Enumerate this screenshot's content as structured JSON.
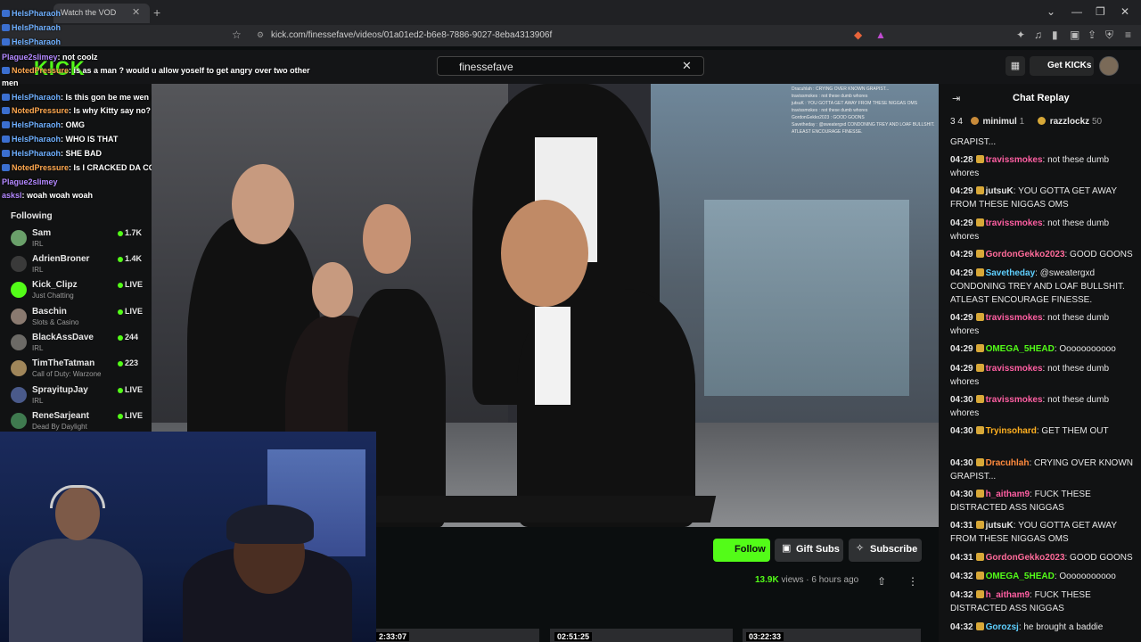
{
  "browser": {
    "tab_title": "Watch the VOD",
    "url": "kick.com/finessefave/videos/01a01ed2-b6e8-7886-9027-8eba4313906f"
  },
  "kick": {
    "logo": "KICK",
    "search_value": "finessefave",
    "get_kicks": "Get KICKs"
  },
  "overlay_chat": [
    {
      "user": "HelsPharaoh",
      "text": ""
    },
    {
      "user": "HelsPharaoh",
      "text": ""
    },
    {
      "user": "HelsPharaoh",
      "text": ""
    },
    {
      "user": "Plague2slimey",
      "text": ": not coolz"
    },
    {
      "user": "NotedPressure",
      "text": ": is as a man ? would u allow yoself to get angry over two other"
    },
    {
      "user": "",
      "text": "men"
    },
    {
      "user": "HelsPharaoh",
      "text": ": Is this gon be me wen i met the big scooter"
    },
    {
      "user": "NotedPressure",
      "text": ": Is why Kitty say no? she a man?"
    },
    {
      "user": "HelsPharaoh",
      "text": ": OMG"
    },
    {
      "user": "HelsPharaoh",
      "text": ": WHO IS THAT"
    },
    {
      "user": "HelsPharaoh",
      "text": ": SHE BAD"
    },
    {
      "user": "NotedPressure",
      "text": ": Is I CRACKED DA CODE"
    },
    {
      "user": "Plague2slimey",
      "text": ""
    },
    {
      "user": "asksl",
      "text": ": woah woah woah"
    }
  ],
  "sidebar": {
    "following_label": "Following",
    "channels": [
      {
        "name": "Sam",
        "category": "IRL",
        "stat": "1.7K",
        "avatar_color": "#6aa06a"
      },
      {
        "name": "AdrienBroner",
        "category": "IRL",
        "stat": "1.4K",
        "avatar_color": "#3a3a3a"
      },
      {
        "name": "Kick_Clipz",
        "category": "Just Chatting",
        "stat": "LIVE",
        "avatar_color": "#53fc18"
      },
      {
        "name": "Baschin",
        "category": "Slots & Casino",
        "stat": "LIVE",
        "avatar_color": "#8a7a70"
      },
      {
        "name": "BlackAssDave",
        "category": "IRL",
        "stat": "244",
        "avatar_color": "#6c6a66"
      },
      {
        "name": "TimTheTatman",
        "category": "Call of Duty: Warzone",
        "stat": "223",
        "avatar_color": "#a0865a"
      },
      {
        "name": "SprayitupJay",
        "category": "IRL",
        "stat": "LIVE",
        "avatar_color": "#4a5a8a"
      },
      {
        "name": "ReneSarjeant",
        "category": "Dead By Daylight",
        "stat": "LIVE",
        "avatar_color": "#3f7a4f"
      }
    ]
  },
  "video_overlay_chat": [
    "Dracuhlah : CRYING OVER KNOWN GRAPIST...",
    "travissmokes : not these dumb whores",
    "jutsuK : YOU GOTTA GET AWAY FROM THESE NIGGAS OMS",
    "travissmokes : not these dumb whores",
    "GordonGekko2023 : GOOD GOONS",
    "Savetheday : @sweatergxd CONDONING TREY AND LOAF BULLSHIT. ATLEAST ENCOURAGE FINESSE."
  ],
  "actions": {
    "follow": "Follow",
    "gift_subs": "Gift Subs",
    "subscribe": "Subscribe"
  },
  "meta": {
    "views": "13.9K",
    "views_label": "views",
    "dot": "·",
    "age": "6 hours ago"
  },
  "thumbnails": [
    {
      "time": "2:33:07"
    },
    {
      "time": "02:51:25"
    },
    {
      "time": "03:22:33"
    }
  ],
  "chat_replay": {
    "title": "Chat Replay",
    "pinned": {
      "count": "3",
      "count2": "4",
      "user1": "minimul",
      "count3": "1",
      "user2": "razzlockz",
      "count4": "50"
    },
    "first_line": "GRAPIST...",
    "messages": [
      {
        "time": "04:28",
        "user": "travissmokes",
        "color": "#ff5fa2",
        "text": ": not these dumb whores"
      },
      {
        "time": "04:29",
        "user": "jutsuK",
        "color": "#e6e6e6",
        "text": ": YOU GOTTA GET AWAY FROM THESE NIGGAS OMS"
      },
      {
        "time": "04:29",
        "user": "travissmokes",
        "color": "#ff5fa2",
        "text": ": not these dumb whores"
      },
      {
        "time": "04:29",
        "user": "GordonGekko2023",
        "color": "#ff6b9a",
        "text": ": GOOD GOONS"
      },
      {
        "time": "04:29",
        "user": "Savetheday",
        "color": "#5fd0ff",
        "text": ": @sweatergxd CONDONING TREY AND LOAF BULLSHIT. ATLEAST ENCOURAGE FINESSE."
      },
      {
        "time": "04:29",
        "user": "travissmokes",
        "color": "#ff5fa2",
        "text": ": not these dumb whores"
      },
      {
        "time": "04:29",
        "user": "OMEGA_5HEAD",
        "color": "#53fc18",
        "text": ": Ooooooooooo"
      },
      {
        "time": "04:29",
        "user": "travissmokes",
        "color": "#ff5fa2",
        "text": ": not these dumb whores"
      },
      {
        "time": "04:30",
        "user": "travissmokes",
        "color": "#ff5fa2",
        "text": ": not these dumb whores"
      },
      {
        "time": "04:30",
        "user": "Tryinsohard",
        "color": "#ffb020",
        "text": ": GET THEM OUT"
      },
      {
        "time": "04:30",
        "user": "Dracuhlah",
        "color": "#ff8a3d",
        "text": ": CRYING OVER KNOWN GRAPIST..."
      },
      {
        "time": "04:30",
        "user": "h_aitham9",
        "color": "#ff5fa2",
        "text": ": FUCK THESE DISTRACTED ASS NIGGAS"
      },
      {
        "time": "04:31",
        "user": "jutsuK",
        "color": "#e6e6e6",
        "text": ": YOU GOTTA GET AWAY FROM THESE NIGGAS OMS"
      },
      {
        "time": "04:31",
        "user": "GordonGekko2023",
        "color": "#ff6b9a",
        "text": ": GOOD GOONS"
      },
      {
        "time": "04:32",
        "user": "OMEGA_5HEAD",
        "color": "#53fc18",
        "text": ": Ooooooooooo"
      },
      {
        "time": "04:32",
        "user": "h_aitham9",
        "color": "#ff5fa2",
        "text": ": FUCK THESE DISTRACTED ASS NIGGAS"
      },
      {
        "time": "04:32",
        "user": "Gorozsj",
        "color": "#5fd0ff",
        "text": ": he brought a baddie"
      }
    ]
  }
}
